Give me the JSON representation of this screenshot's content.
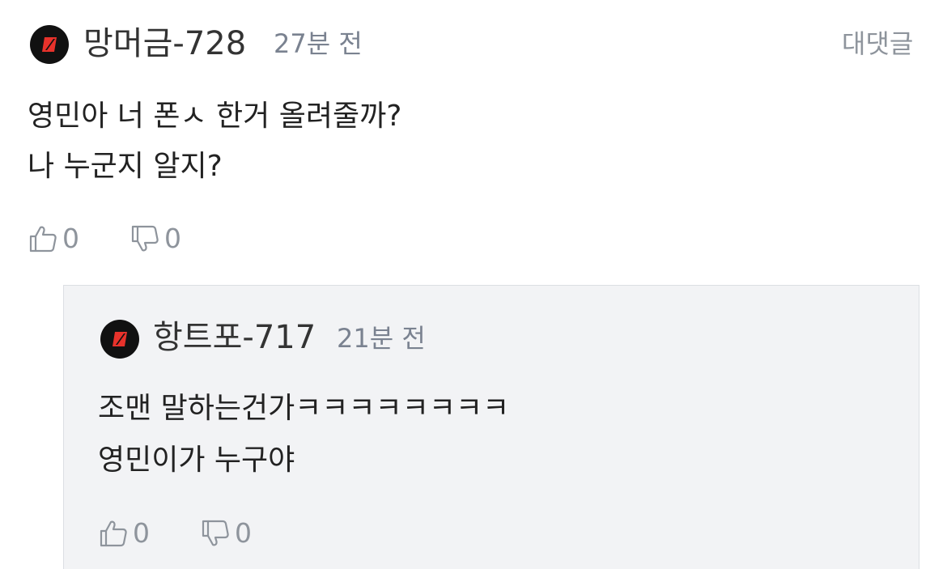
{
  "comment": {
    "username": "망머금-728",
    "time": "27분 전",
    "reply_label": "대댓글",
    "lines": [
      "영민아 너 폰ㅅ 한거 올려줄까?",
      "나 누군지 알지?"
    ],
    "likes": "0",
    "dislikes": "0"
  },
  "reply": {
    "username": "항트포-717",
    "time": "21분 전",
    "lines": [
      "조맨 말하는건가ㅋㅋㅋㅋㅋㅋㅋㅋ",
      "영민이가 누구야"
    ],
    "likes": "0",
    "dislikes": "0"
  },
  "colors": {
    "avatar_bg": "#111111",
    "avatar_mark": "#e8322b",
    "reply_bg": "#f2f3f5",
    "muted_text": "#8e949c"
  },
  "icons": {
    "avatar": "red-slash-logo-icon",
    "like": "thumbs-up-icon",
    "dislike": "thumbs-down-icon"
  }
}
